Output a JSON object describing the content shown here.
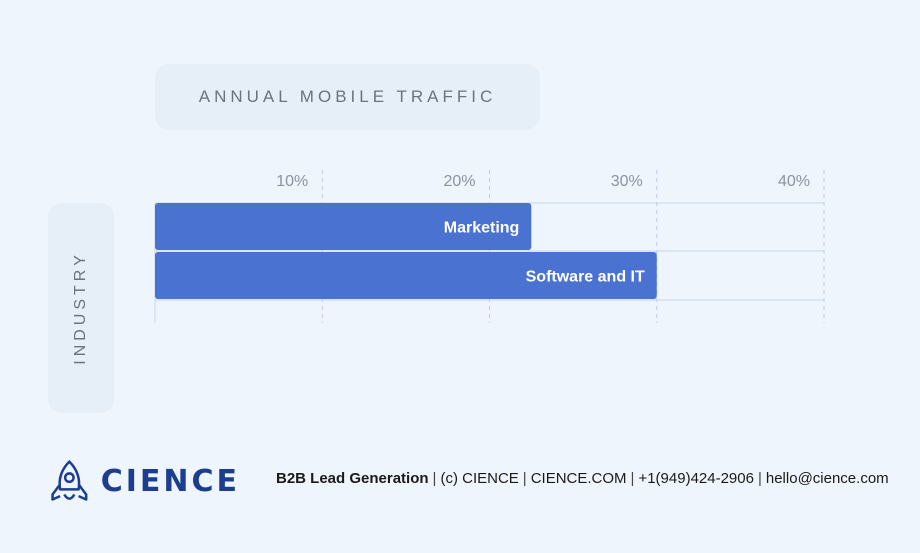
{
  "chart_data": {
    "type": "bar",
    "orientation": "horizontal",
    "title": "ANNUAL MOBILE TRAFFIC",
    "ylabel": "INDUSTRY",
    "xlabel": "",
    "categories": [
      "Marketing",
      "Software and IT"
    ],
    "values": [
      22.5,
      30
    ],
    "xlim": [
      0,
      40
    ],
    "xticks": [
      10,
      20,
      30,
      40
    ],
    "xtick_labels": [
      "10%",
      "20%",
      "30%",
      "40%"
    ],
    "grid": true,
    "bar_color": "#4a72d0"
  },
  "footer": {
    "brand": "CIENCE",
    "tagline": "B2B Lead Generation",
    "copyright": "(c) CIENCE",
    "website": "CIENCE.COM",
    "phone": "+1(949)424-2906",
    "email": "hello@cience.com",
    "logo_color": "#1d3e8e"
  }
}
